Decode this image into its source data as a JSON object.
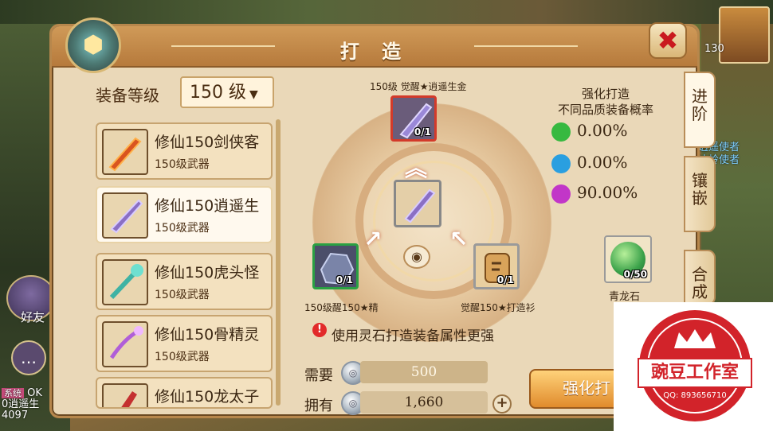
{
  "window": {
    "title": "打 造"
  },
  "hud": {
    "friend_label": "好友",
    "chat_tag": "系统",
    "chat_line1": "OK",
    "chat_line2": "0逍遥生",
    "chat_line3": "4097",
    "level_badge": "130",
    "right_text1": "逍遥使者",
    "right_text2": "冰岭使者"
  },
  "equip_level": {
    "label": "装备等级",
    "selected": "150 级",
    "arrow": "▼"
  },
  "items": [
    {
      "name": "修仙150剑侠客",
      "sub": "150级武器",
      "color": "#d9541f"
    },
    {
      "name": "修仙150逍遥生",
      "sub": "150级武器",
      "color": "#8a6fc4"
    },
    {
      "name": "修仙150虎头怪",
      "sub": "150级武器",
      "color": "#3fb3a4"
    },
    {
      "name": "修仙150骨精灵",
      "sub": "150级武器",
      "color": "#b05ed8"
    },
    {
      "name": "修仙150龙太子",
      "sub": "",
      "color": "#c43030"
    }
  ],
  "craft": {
    "top_label": "150级 觉醒★逍遥生金",
    "top_count": "0/1",
    "left_label": "150级醒150★精",
    "left_count": "0/1",
    "right_label": "觉醒150★打造衫",
    "right_count": "0/1"
  },
  "probability": {
    "title_line1": "强化打造",
    "title_line2": "不同品质装备概率",
    "rows": [
      {
        "color": "#37b940",
        "value": "0.00%"
      },
      {
        "color": "#2a9fe0",
        "value": "0.00%"
      },
      {
        "color": "#c236c8",
        "value": "90.00%"
      }
    ]
  },
  "material": {
    "name": "青龙石",
    "count": "0/50"
  },
  "tabs": [
    {
      "label": "进阶"
    },
    {
      "label": "镶嵌"
    },
    {
      "label": "合成"
    }
  ],
  "tip": {
    "icon": "!",
    "text": "使用灵石打造装备属性更强"
  },
  "cost": {
    "need_label": "需要",
    "need_value": "500",
    "have_label": "拥有",
    "have_value": "1,660",
    "plus": "+"
  },
  "forge_button": "强化打",
  "watermark": {
    "text": "豌豆工作室",
    "qq": "QQ: 893656710"
  }
}
